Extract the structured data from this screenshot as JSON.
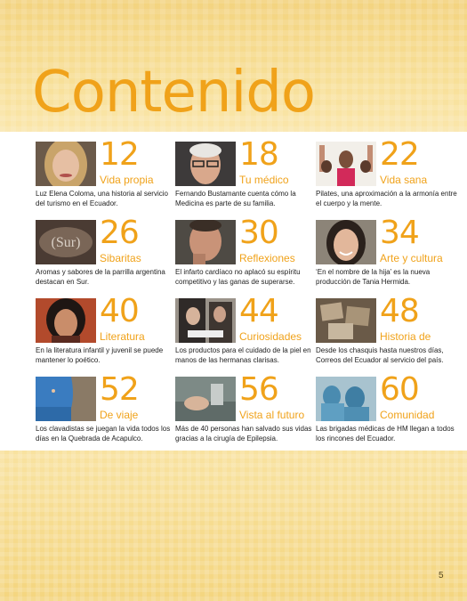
{
  "title": "Contenido",
  "page_number": "5",
  "colors": {
    "accent": "#f0a21a",
    "background": "#f6dc8e",
    "panel": "#ffffff"
  },
  "entries": [
    {
      "number": "12",
      "section": "Vida propia",
      "description": "Luz Elena Coloma, una historia al servicio del turismo en el Ecuador.",
      "image": "portrait-woman-blonde"
    },
    {
      "number": "18",
      "section": "Tu médico",
      "description": "Fernando Bustamante cuenta cómo la Medicina es parte de su familia.",
      "image": "portrait-elderly-man-glasses"
    },
    {
      "number": "22",
      "section": "Vida sana",
      "description": "Pilates, una aproximación a la armonía entre el cuerpo y la mente.",
      "image": "pilates-women-arms-raised"
    },
    {
      "number": "26",
      "section": "Sibaritas",
      "description": "Aromas y sabores de la parrilla argentina destacan en Sur.",
      "image": "restaurant-logo-sur"
    },
    {
      "number": "30",
      "section": "Reflexiones",
      "description": "El infarto cardíaco no aplacó su espíritu competitivo y las ganas de superarse.",
      "image": "portrait-man-thinking"
    },
    {
      "number": "34",
      "section": "Arte y cultura",
      "description": "‘En el nombre de la hija’ es la nueva producción de Tania Hermida.",
      "image": "portrait-woman-smiling"
    },
    {
      "number": "40",
      "section": "Literatura",
      "description": "En la literatura infantil y juvenil se puede mantener lo poético.",
      "image": "portrait-woman-dark-hair"
    },
    {
      "number": "44",
      "section": "Curiosidades",
      "description": "Los productos para el cuidado de la piel en manos de las hermanas clarisas.",
      "image": "nuns-working"
    },
    {
      "number": "48",
      "section": "Historia de",
      "description": "Desde los chasquis hasta nuestros días, Correos del Ecuador al servicio del país.",
      "image": "mail-letters"
    },
    {
      "number": "52",
      "section": "De viaje",
      "description": "Los clavadistas se juegan la vida todos los días en la Quebrada de Acapulco.",
      "image": "cliff-divers-acapulco"
    },
    {
      "number": "56",
      "section": "Vista al futuro",
      "description": "Más de 40 personas han salvado sus vidas gracias a la cirugía de Epilepsia.",
      "image": "surgery-operating-room"
    },
    {
      "number": "60",
      "section": "Comunidad",
      "description": "Las brigadas médicas de HM llegan a todos los rincones del Ecuador.",
      "image": "medical-team-surgeons"
    }
  ]
}
